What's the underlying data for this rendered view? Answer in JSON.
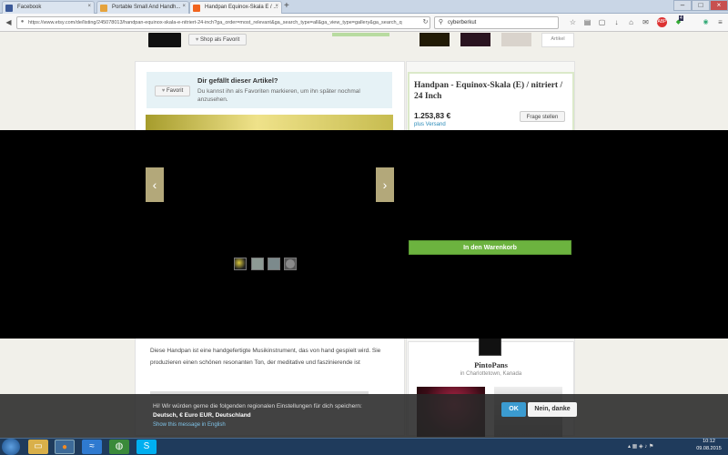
{
  "browser": {
    "tabs": [
      {
        "label": "Facebook",
        "color": "#3b5998"
      },
      {
        "label": "Portable Small And Handh...",
        "color": "#e5a33d"
      },
      {
        "label": "Handpan Equinox-Skala E / ...",
        "color": "#f1641e"
      }
    ],
    "new_tab": "+",
    "url": "https://www.etsy.com/de/listing/245078013/handpan-equinox-skala-e-nitriert-24-inch?ga_order=most_relevant&ga_search_type=all&ga_view_type=gallery&ga_search_q",
    "search_value": "cyberberkut",
    "addon_badge": "4"
  },
  "shop_strip": {
    "favorite_shop": "Shop als Favorit",
    "artikel": "Artikel"
  },
  "favorite_box": {
    "button": "Favorit",
    "title": "Dir gefällt dieser Artikel?",
    "text": "Du kannst ihn als Favoriten markieren, um ihn später nochmal anzusehen."
  },
  "product": {
    "title": "Handpan - Equinox-Skala (E) / nitriert / 24 Inch",
    "price": "1.253,83 €",
    "shipping": "plus Versand",
    "ask_button": "Frage stellen",
    "cart_button": "In den Warenkorb"
  },
  "gallery": {
    "prev": "‹",
    "next": "›",
    "thumb_colors": [
      "#c6b330",
      "#8d9a94",
      "#7c8a8c",
      "#8a8a8a"
    ]
  },
  "description": "Diese Handpan ist eine handgefertigte Musikinstrument, das von hand gespielt wird. Sie produzieren einen schönen resonanten Ton, der meditative und faszinierende ist",
  "seller": {
    "name": "PintoPans",
    "location": "in Charlottetown, Kanada"
  },
  "cookie": {
    "line1": "Hi! Wir würden gerne die folgenden regionalen Einstellungen für dich speichern:",
    "line2": "Deutsch, € Euro EUR, Deutschland",
    "line3": "Show this message in English",
    "ok": "OK",
    "no": "Nein, danke"
  },
  "taskbar": {
    "time": "10:12",
    "date": "09.08.2015"
  },
  "colors": {
    "etsy_green": "#6cb33f",
    "cookie_blue": "#3b9bd0",
    "link": "#2a8ab8"
  }
}
